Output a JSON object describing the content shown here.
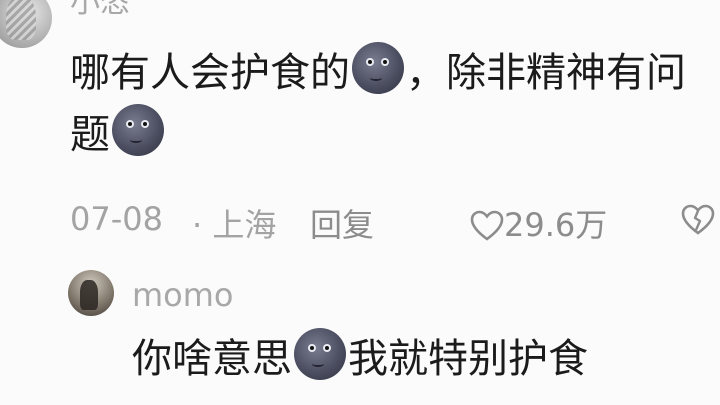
{
  "comment": {
    "username": "小恣",
    "text_part1": "哪有人会护食的",
    "text_part2": "，除非精神有问题",
    "date": "07-08",
    "location": "· 上海",
    "reply_label": "回复",
    "likes": "29.6万",
    "icons": [
      "avatar",
      "emoji-face-icon",
      "heart-icon",
      "dislike-icon"
    ]
  },
  "reply": {
    "username": "momo",
    "text_part1": "你啥意思",
    "text_part2": "我就特别护食",
    "icons": [
      "avatar",
      "emoji-face-icon"
    ]
  }
}
